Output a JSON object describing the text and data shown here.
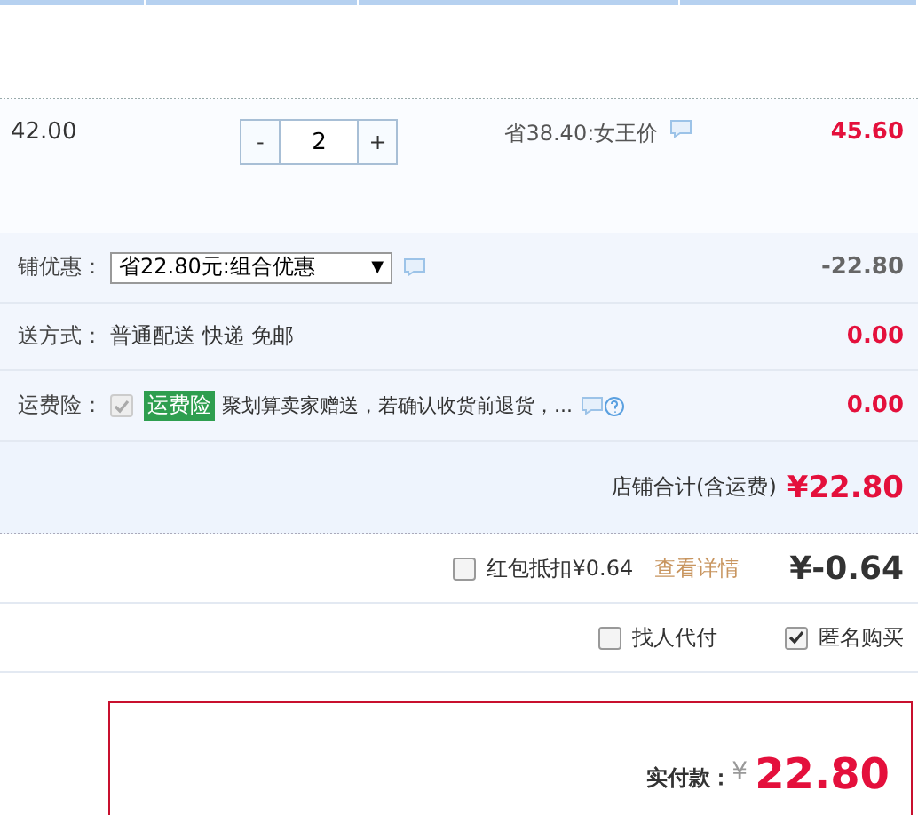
{
  "item": {
    "unit_price": "42.00",
    "quantity": {
      "minus": "-",
      "value": "2",
      "plus": "+"
    },
    "promo": "省38.40:女王价",
    "subtotal": "45.60"
  },
  "shop_discount": {
    "label": "铺优惠：",
    "select": "省22.80元:组合优惠",
    "caret": "▼",
    "amount": "-22.80"
  },
  "shipping": {
    "label": "送方式：",
    "value": "普通配送 快递 免邮",
    "amount": "0.00"
  },
  "insurance": {
    "label": "运费险：",
    "checked": true,
    "disabled": true,
    "tag": "运费险",
    "text": "聚划算卖家赠送，若确认收货前退货，...",
    "amount": "0.00"
  },
  "shop_total": {
    "label": "店铺合计(含运费)",
    "amount": "¥22.80"
  },
  "red_packet": {
    "checked": false,
    "label": "红包抵扣¥0.64",
    "link": "查看详情",
    "amount": "¥-0.64"
  },
  "options": [
    {
      "label": "找人代付",
      "checked": false
    },
    {
      "label": "匿名购买",
      "checked": true
    }
  ],
  "payment": {
    "label": "实付款：",
    "currency": "¥",
    "amount": "22.80"
  }
}
